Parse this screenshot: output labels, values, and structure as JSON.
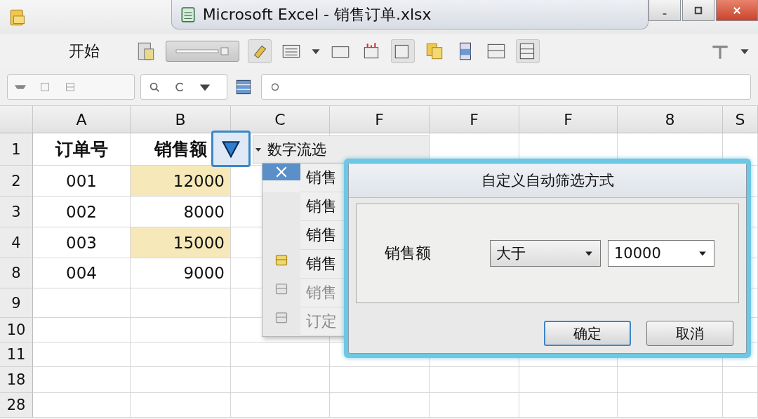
{
  "window": {
    "title": "Microsoft Excel - 销售订单.xlsx"
  },
  "ribbon": {
    "tab": "开始"
  },
  "sheet": {
    "columns": [
      "A",
      "B",
      "C",
      "F",
      "F",
      "F",
      "8",
      "S"
    ],
    "rows": [
      {
        "number": "1",
        "kind": "header",
        "cells": [
          {
            "text": "订单号",
            "highlighted": false
          },
          {
            "text": "销售额",
            "highlighted": false
          }
        ]
      },
      {
        "number": "2",
        "kind": "data",
        "cells": [
          {
            "text": "001",
            "highlighted": false
          },
          {
            "text": "12000",
            "highlighted": true
          }
        ]
      },
      {
        "number": "3",
        "kind": "data",
        "cells": [
          {
            "text": "002",
            "highlighted": false
          },
          {
            "text": "8000",
            "highlighted": false
          }
        ]
      },
      {
        "number": "4",
        "kind": "data",
        "cells": [
          {
            "text": "003",
            "highlighted": false
          },
          {
            "text": "15000",
            "highlighted": true
          }
        ]
      },
      {
        "number": "8",
        "kind": "data",
        "cells": [
          {
            "text": "004",
            "highlighted": false
          },
          {
            "text": "9000",
            "highlighted": false
          }
        ]
      },
      {
        "number": "9",
        "cells": []
      },
      {
        "number": "10",
        "cells": []
      },
      {
        "number": "11",
        "cells": []
      },
      {
        "number": "18",
        "cells": []
      },
      {
        "number": "28",
        "cells": []
      }
    ]
  },
  "filter_menu": {
    "title": "数字流选",
    "items": [
      {
        "label": "销售",
        "kind": "marked",
        "selected": true,
        "disabled": false
      },
      {
        "label": "销售",
        "kind": "plain",
        "selected": false,
        "disabled": false
      },
      {
        "label": "销售",
        "kind": "plain",
        "selected": false,
        "disabled": false
      },
      {
        "label": "销售",
        "kind": "icon",
        "selected": false,
        "disabled": false
      },
      {
        "label": "销售",
        "kind": "icon",
        "selected": false,
        "disabled": true
      },
      {
        "label": "订定",
        "kind": "icon",
        "selected": false,
        "disabled": true
      }
    ]
  },
  "dialog": {
    "title": "自定义自动筛选方式",
    "field_label": "销售额",
    "operator": "大于",
    "value": "10000",
    "buttons": [
      {
        "label": "确定",
        "selected": true
      },
      {
        "label": "取消",
        "selected": false
      }
    ]
  }
}
